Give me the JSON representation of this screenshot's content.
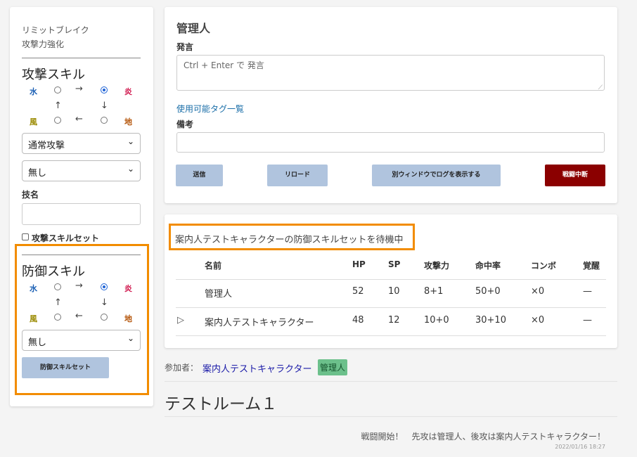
{
  "left": {
    "limit_break": "リミットブレイク",
    "attack_boost": "攻撃力強化",
    "attack_skill": {
      "heading": "攻撃スキル",
      "el_water": "水",
      "el_fire": "炎",
      "el_wind": "風",
      "el_earth": "地",
      "arrow_right": "→",
      "arrow_up": "↑",
      "arrow_down": "↓",
      "arrow_left": "←",
      "select1": "通常攻撃",
      "select2": "無し",
      "name_label": "技名",
      "checkbox_label": "攻撃スキルセット"
    },
    "defense_skill": {
      "heading": "防御スキル",
      "el_water": "水",
      "el_fire": "炎",
      "el_wind": "風",
      "el_earth": "地",
      "arrow_right": "→",
      "arrow_up": "↑",
      "arrow_down": "↓",
      "arrow_left": "←",
      "select": "無し",
      "button": "防御スキルセット"
    }
  },
  "main": {
    "title": "管理人",
    "speech_label": "発言",
    "speech_placeholder": "Ctrl + Enter で 発言",
    "tags_link": "使用可能タグ一覧",
    "notes_label": "備考",
    "buttons": {
      "send": "送信",
      "reload": "リロード",
      "popout": "別ウィンドウでログを表示する",
      "abort": "戦闘中断"
    }
  },
  "status": {
    "message": "案内人テストキャラクターの防御スキルセットを待機中",
    "headers": [
      "名前",
      "HP",
      "SP",
      "攻撃力",
      "命中率",
      "コンボ",
      "覚醒"
    ],
    "rows": [
      {
        "marker": "",
        "name": "管理人",
        "hp": "52",
        "sp": "10",
        "atk": "8+1",
        "hit": "50+0",
        "combo": "×0",
        "awaken": "—"
      },
      {
        "marker": "▷",
        "name": "案内人テストキャラクター",
        "hp": "48",
        "sp": "12",
        "atk": "10+0",
        "hit": "30+10",
        "combo": "×0",
        "awaken": "—"
      }
    ]
  },
  "participants": {
    "label": "参加者：",
    "name1": "案内人テストキャラクター",
    "name2": "管理人"
  },
  "room_title": "テストルーム１",
  "log": {
    "message": "戦闘開始！　先攻は管理人、後攻は案内人テストキャラクター！",
    "timestamp": "2022/01/16 18:27"
  },
  "colors": {
    "highlight": "#f28c00",
    "button_blue": "#b0c4de",
    "button_red": "#8b0000",
    "tag_green": "#6cc08b"
  }
}
